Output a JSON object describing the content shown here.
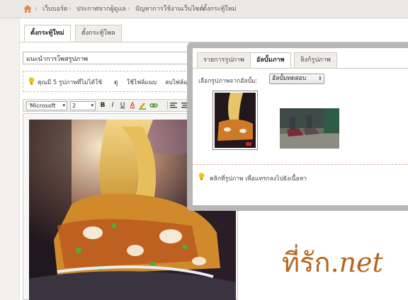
{
  "breadcrumb": {
    "home_icon": "home-icon",
    "items": [
      "เว็บบอร์ด",
      "ประกาศจากผู้ดูแล",
      "ปัญหาการใช้งานเว็บไซต์",
      "ตั้งกระทู้ใหม่"
    ]
  },
  "main_tabs": [
    "ตั้งกระทู้ใหม่",
    "ตั้งกระทู้โพล"
  ],
  "title_input": {
    "value": "แนะนำการโพสรูปภาพ"
  },
  "info": {
    "text": "คุณมี 5 รูปภาพที่ไม่ได้ใช้",
    "links": [
      "ดู",
      "ใช้ไฟล์แนบ",
      "ลบไฟล์แนบ"
    ]
  },
  "toolbar": {
    "font_select": "'Microsoft",
    "size_select": "2",
    "bold": "B",
    "italic": "I",
    "underline": "U",
    "font_color": "A"
  },
  "popup": {
    "tabs": [
      "รายการรูปภาพ",
      "อัลบั้มภาพ",
      "ลิงก์รูปภาพ"
    ],
    "album_label": "เลือกรูปภาพจากอัลบั้ม:",
    "album_value": "อัลบั้มทดสอบ",
    "hint": "คลิกที่รูปภาพ เพื่อแทรกลงไปยังเนื้อหา"
  },
  "brand": {
    "thai": "ที่รัก",
    "dot": ".",
    "net": "net"
  },
  "colors": {
    "brand": "#b5651d",
    "accent_border": "#e0b4a6",
    "bulb": "#f2c700"
  }
}
